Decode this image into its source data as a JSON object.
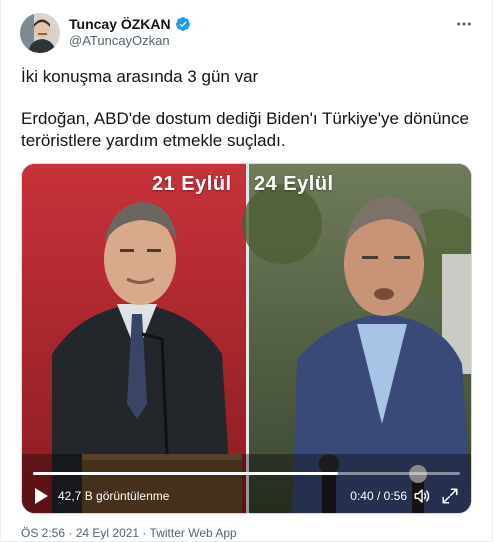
{
  "author": {
    "display_name": "Tuncay ÖZKAN",
    "handle": "@ATuncayOzkan",
    "verified": true,
    "avatar_icon": "avatar-photo",
    "verified_icon": "verified-badge-icon"
  },
  "tweet": {
    "lines": [
      "İki konuşma arasında 3 gün var",
      "Erdoğan, ABD'de dostum dediği Biden'ı Türkiye'ye dönünce teröristlere yardım etmekle suçladı."
    ]
  },
  "video": {
    "left_label": "21 Eylül",
    "right_label": "24 Eylül",
    "views": "42,7 B görüntülenme",
    "time": "0:40 / 0:56",
    "progress": 0.714,
    "icons": [
      "play-icon",
      "volume-icon",
      "fullscreen-icon"
    ]
  },
  "meta": {
    "time": "ÖS 2:56",
    "separator": " · ",
    "date": "24 Eyl 2021",
    "source": "Twitter Web App"
  },
  "colors": {
    "text": "#0f1419",
    "secondary": "#536471",
    "verified": "#1d9bf0",
    "left_bg": "#b4222b",
    "right_bg": "#4a5a3a"
  }
}
